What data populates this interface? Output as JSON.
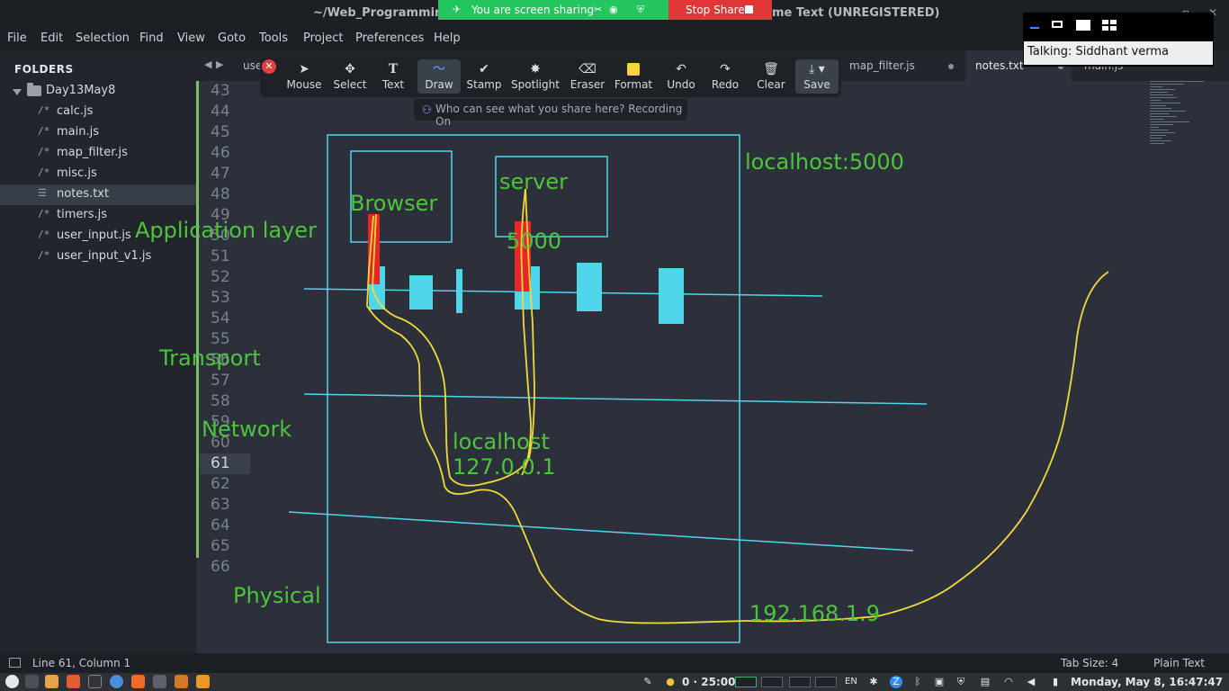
{
  "window": {
    "title_left": "~/Web_Programming_",
    "title_right": "me Text (UNREGISTERED)"
  },
  "screen_share": {
    "status": "You are screen sharing",
    "stop_label": "Stop Share"
  },
  "menu": {
    "items": [
      "File",
      "Edit",
      "Selection",
      "Find",
      "View",
      "Goto",
      "Tools",
      "Project",
      "Preferences",
      "Help"
    ]
  },
  "sidebar": {
    "title": "FOLDERS",
    "folder": "Day13May8",
    "files": [
      {
        "name": "calc.js",
        "icon": "/*"
      },
      {
        "name": "main.js",
        "icon": "/*"
      },
      {
        "name": "map_filter.js",
        "icon": "/*"
      },
      {
        "name": "misc.js",
        "icon": "/*"
      },
      {
        "name": "notes.txt",
        "icon": "☰"
      },
      {
        "name": "timers.js",
        "icon": "/*"
      },
      {
        "name": "user_input.js",
        "icon": "/*"
      },
      {
        "name": "user_input_v1.js",
        "icon": "/*"
      }
    ],
    "selected_file": "notes.txt"
  },
  "tabs": [
    {
      "label": "use"
    },
    {
      "label": "map_filter.js"
    },
    {
      "label": "notes.txt",
      "active": true
    },
    {
      "label": "main.js"
    }
  ],
  "editor": {
    "line_numbers": [
      "43",
      "44",
      "45",
      "46",
      "47",
      "48",
      "49",
      "50",
      "51",
      "52",
      "53",
      "54",
      "55",
      "56",
      "57",
      "58",
      "59",
      "60",
      "61",
      "62",
      "63",
      "64",
      "65",
      "66"
    ],
    "current_line": "61"
  },
  "annotation_toolbar": {
    "tools": [
      {
        "label": "Mouse",
        "icon": "cursor-icon"
      },
      {
        "label": "Select",
        "icon": "move-icon"
      },
      {
        "label": "Text",
        "icon": "text-icon"
      },
      {
        "label": "Draw",
        "icon": "draw-icon",
        "selected": true
      },
      {
        "label": "Stamp",
        "icon": "check-icon"
      },
      {
        "label": "Spotlight",
        "icon": "spotlight-icon"
      },
      {
        "label": "Eraser",
        "icon": "eraser-icon"
      },
      {
        "label": "Format",
        "icon": "format-icon"
      },
      {
        "label": "Undo",
        "icon": "undo-icon"
      },
      {
        "label": "Redo",
        "icon": "redo-icon"
      },
      {
        "label": "Clear",
        "icon": "trash-icon"
      },
      {
        "label": "Save",
        "icon": "save-icon"
      }
    ],
    "tip": "Who can see what you share here? Recording On"
  },
  "zoom_panel": {
    "talking": "Talking: Siddhant verma"
  },
  "drawing": {
    "labels": {
      "browser": "Browser",
      "server": "server",
      "localhost_port": "localhost:5000",
      "port": "5000",
      "application_layer": "Application layer",
      "transport": "Transport",
      "network": "Network",
      "localhost": "localhost",
      "loopback_ip": "127.0.0.1",
      "physical": "Physical",
      "lan_ip": "192.168.1.9"
    },
    "colors": {
      "label": "#4ec43a",
      "box": "#4fd6e8",
      "block": "#4fd6e8",
      "red": "#e8262a",
      "pen": "#f2d93b"
    }
  },
  "status_bar": {
    "position": "Line 61, Column 1",
    "tab_size": "Tab Size: 4",
    "syntax": "Plain Text"
  },
  "taskbar": {
    "timer": "0 · 25:00",
    "lang": "EN",
    "clock": "Monday, May  8, 16:47:47"
  }
}
